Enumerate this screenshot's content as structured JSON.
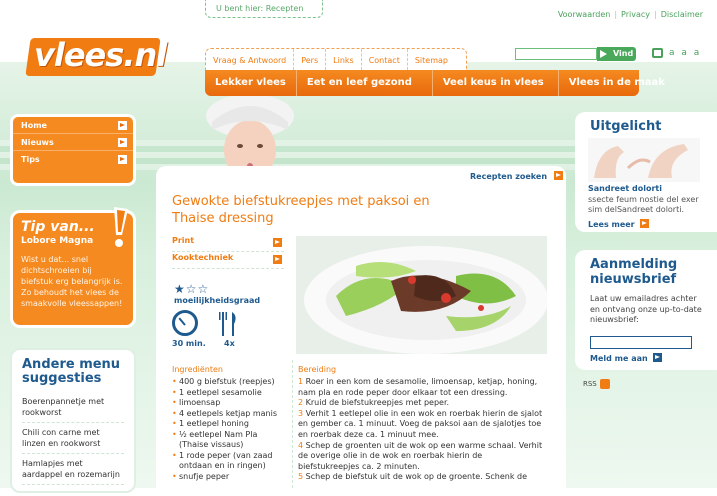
{
  "breadcrumb": "U bent hier: Recepten",
  "toplinks": [
    "Voorwaarden",
    "Privacy",
    "Disclaimer"
  ],
  "logo": "vlees.nl",
  "search": {
    "button": "Vind",
    "value": ""
  },
  "font_sizes": "a a a",
  "subnav": [
    "Vraag & Antwoord",
    "Pers",
    "Links",
    "Contact",
    "Sitemap"
  ],
  "mainnav": [
    "Lekker vlees",
    "Eet en leef gezond",
    "Veel keus in vlees",
    "Vlees in de maak"
  ],
  "leftmenu": [
    "Home",
    "Nieuws",
    "Tips"
  ],
  "tip": {
    "title": "Tip van...",
    "author": "Lobore Magna",
    "text": "Wist u dat... snel dichtschroeien bij biefstuk erg belangrijk is. Zo behoudt het vlees de smaakvolle vleessappen!"
  },
  "other_menu": {
    "title": "Andere menu suggesties",
    "items": [
      "Boerenpannetje met rookworst",
      "Chili con carne met linzen en rookworst",
      "Hamlapjes met aardappel en rozemarijn"
    ]
  },
  "recipe": {
    "search_link": "Recepten zoeken",
    "title": "Gewokte biefstukreepjes met paksoi en Thaise dressing",
    "actions": [
      "Print",
      "Kooktechniek"
    ],
    "difficulty_label": "moeilijkheidsgraad",
    "difficulty_stars": 1,
    "time": "30 min.",
    "persons": "4x",
    "ingredients_title": "Ingrediënten",
    "ingredients": [
      "400 g biefstuk (reepjes)",
      "1 eetlepel sesamolie",
      "limoensap",
      "4 eetlepels ketjap manis",
      "1 eetlepel honing",
      "½ eetlepel Nam Pla (Thaise vissaus)",
      "1 rode peper (van zaad ontdaan en in ringen)",
      "snufje peper"
    ],
    "steps_title": "Bereiding",
    "steps": [
      {
        "n": "1",
        "text": "Roer in een kom de sesamolie, limoensap, ketjap, honing, nam pla en rode peper door elkaar tot een dressing."
      },
      {
        "n": "2",
        "text": "Kruid de biefstukreepjes met peper."
      },
      {
        "n": "3",
        "text": "Verhit 1 eetlepel olie in een wok en roerbak hierin de sjalot en gember ca. 1 minuut. Voeg de paksoi aan de sjalotjes toe en roerbak deze ca. 1 minuut mee."
      },
      {
        "n": "4",
        "text": "Schep de groenten uit de wok op een warme schaal. Verhit de overige olie in de wok en roerbak hierin de biefstukreepjes ca. 2 minuten."
      },
      {
        "n": "5",
        "text": "Schep de biefstuk uit de wok op de groente. Schenk de"
      }
    ]
  },
  "featured": {
    "title": "Uitgelicht",
    "name": "Sandreet dolorti",
    "text": "ssecte feum nostie del exer sim delSandreet dolorti.",
    "more": "Lees meer"
  },
  "newsletter": {
    "title": "Aanmelding nieuwsbrief",
    "text": "Laat uw emailadres achter en ontvang onze up-to-date nieuwsbrief:",
    "button": "Meld me aan"
  },
  "rss": "RSS"
}
